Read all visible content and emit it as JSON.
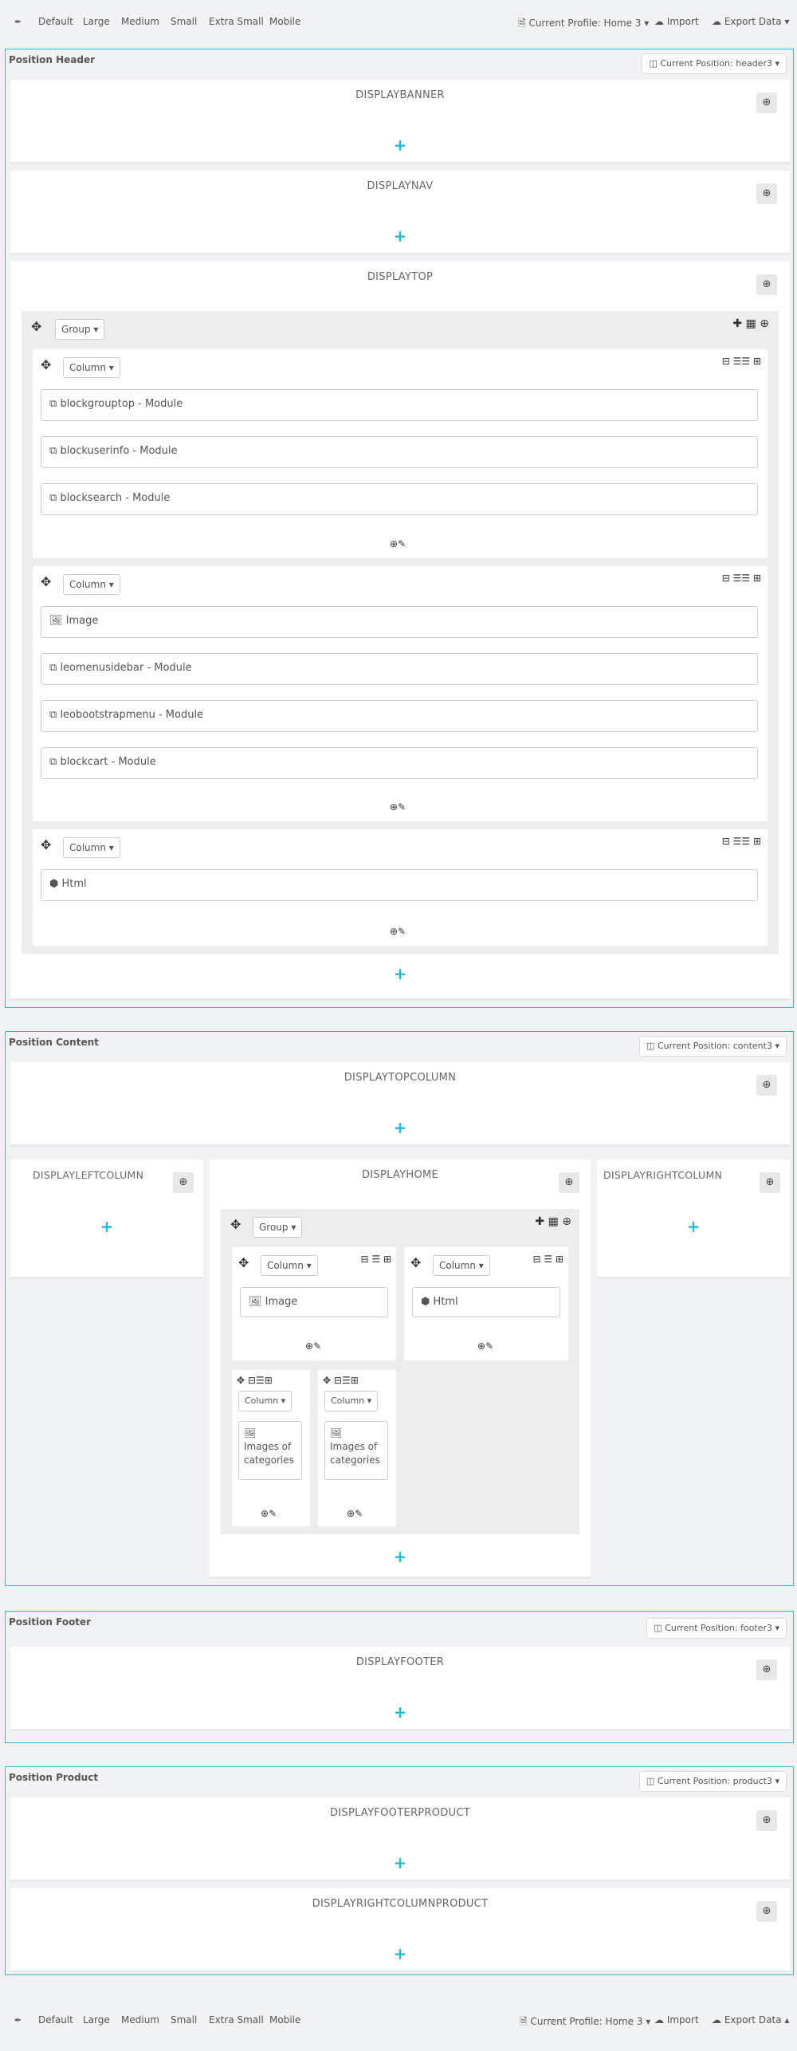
{
  "toolbar": {
    "pin_icon": "pin-icon",
    "sizes": [
      "Default",
      "Large",
      "Medium",
      "Small",
      "Extra Small",
      "Mobile"
    ],
    "profile_label": "Current Profile: Home 3",
    "import_label": "Import",
    "export_label": "Export Data"
  },
  "header": {
    "title": "Position Header",
    "current_position": "Current Position: header3",
    "hooks": {
      "banner": "DISPLAYBANNER",
      "nav": "DISPLAYNAV",
      "top": "DISPLAYTOP"
    },
    "group_label": "Group",
    "column_label": "Column",
    "col1_widgets": [
      "blockgrouptop - Module",
      "blockuserinfo - Module",
      "blocksearch - Module"
    ],
    "col2_widgets": [
      "Image",
      "leomenusidebar - Module",
      "leobootstrapmenu - Module",
      "blockcart - Module"
    ],
    "col3_widgets": [
      "Html"
    ]
  },
  "content": {
    "title": "Position Content",
    "current_position": "Current Position: content3",
    "hooks": {
      "topcolumn": "DISPLAYTOPCOLUMN",
      "leftcolumn": "DISPLAYLEFTCOLUMN",
      "home": "DISPLAYHOME",
      "rightcolumn": "DISPLAYRIGHTCOLUMN"
    },
    "group_label": "Group",
    "column_label": "Column",
    "widgets": {
      "image": "Image",
      "html": "Html",
      "images_cat_1": "Images of",
      "images_cat_2": "categories"
    }
  },
  "footer": {
    "title": "Position Footer",
    "current_position": "Current Position: footer3",
    "hook": "DISPLAYFOOTER"
  },
  "product": {
    "title": "Position Product",
    "current_position": "Current Position: product3",
    "hooks": {
      "footerproduct": "DISPLAYFOOTERPRODUCT",
      "rightcolumnproduct": "DISPLAYRIGHTCOLUMNPRODUCT"
    }
  },
  "colors": {
    "accent": "#25b9d7",
    "background": "#f1f2f3",
    "panel": "#ffffff"
  }
}
